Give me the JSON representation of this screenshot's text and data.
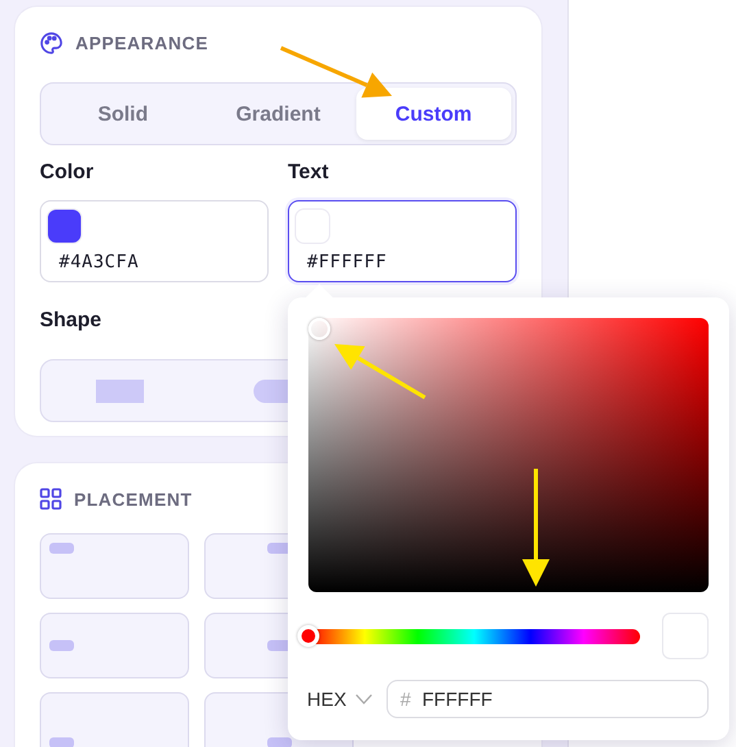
{
  "appearance": {
    "title": "APPEARANCE",
    "tabs": [
      {
        "label": "Solid",
        "selected": false
      },
      {
        "label": "Gradient",
        "selected": false
      },
      {
        "label": "Custom",
        "selected": true
      }
    ],
    "fields": [
      {
        "label": "Color",
        "value": "#4A3CFA",
        "color": "#4a3cfa",
        "focused": false
      },
      {
        "label": "Text",
        "value": "#FFFFFF",
        "color": "#ffffff",
        "focused": true
      }
    ],
    "shape": {
      "label": "Shape",
      "options": [
        {
          "kind": "square"
        },
        {
          "kind": "pill"
        }
      ]
    }
  },
  "placement": {
    "title": "PLACEMENT",
    "cells": [
      {
        "kind": "top-left"
      },
      {
        "kind": "top-center"
      },
      {
        "kind": "middle-left"
      },
      {
        "kind": "middle-center"
      },
      {
        "kind": "bottom-left"
      },
      {
        "kind": "bottom-center"
      }
    ]
  },
  "picker": {
    "hue": {
      "level": 0
    },
    "preview": {
      "color": "#ffffff"
    },
    "format": "HEX",
    "hex": {
      "prefix": "#",
      "value": "FFFFFF"
    }
  },
  "annotations": [
    {
      "color": "#f7a600"
    },
    {
      "color": "#ffe400"
    },
    {
      "color": "#ffe400"
    }
  ]
}
